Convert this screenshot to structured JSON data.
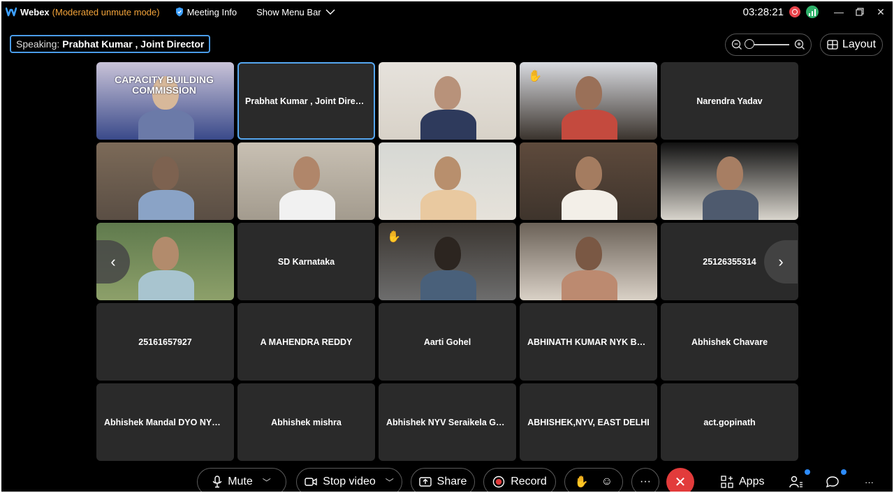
{
  "window": {
    "app_name": "Webex",
    "mode": "(Moderated unmute mode)",
    "meeting_info": "Meeting Info",
    "show_menu_bar": "Show Menu Bar",
    "clock": "03:28:21"
  },
  "speaking": {
    "label": "Speaking:",
    "name": "Prabhat Kumar , Joint Director"
  },
  "layout_button": "Layout",
  "tiles": [
    {
      "name": "",
      "video": true,
      "banner": "CAPACITY BUILDING COMMISSION"
    },
    {
      "name": "Prabhat Kumar , Joint Director",
      "video": false,
      "active": true
    },
    {
      "name": "",
      "video": true
    },
    {
      "name": "",
      "video": true,
      "hand": true
    },
    {
      "name": "Narendra Yadav",
      "video": false
    },
    {
      "name": "",
      "video": true
    },
    {
      "name": "",
      "video": true
    },
    {
      "name": "",
      "video": true
    },
    {
      "name": "",
      "video": true
    },
    {
      "name": "",
      "video": true
    },
    {
      "name": "",
      "video": true
    },
    {
      "name": "SD Karnataka",
      "video": false
    },
    {
      "name": "",
      "video": true,
      "hand": true
    },
    {
      "name": "",
      "video": true
    },
    {
      "name": "25126355314",
      "video": false
    },
    {
      "name": "25161657927",
      "video": false
    },
    {
      "name": "A MAHENDRA REDDY",
      "video": false
    },
    {
      "name": "Aarti Gohel",
      "video": false
    },
    {
      "name": "ABHINATH KUMAR NYK BH...",
      "video": false
    },
    {
      "name": "Abhishek Chavare",
      "video": false
    },
    {
      "name": "Abhishek Mandal DYO NYK ...",
      "video": false
    },
    {
      "name": "Abhishek mishra",
      "video": false
    },
    {
      "name": "Abhishek NYV Seraikela Gam...",
      "video": false
    },
    {
      "name": "ABHISHEK,NYV, EAST DELHI",
      "video": false
    },
    {
      "name": "act.gopinath",
      "video": false
    }
  ],
  "toolbar": {
    "mute": "Mute",
    "stop_video": "Stop video",
    "share": "Share",
    "record": "Record",
    "apps": "Apps"
  },
  "colors": {
    "accent": "#4a9ce8",
    "end_call": "#e23b3b",
    "moderated": "#f2a33a",
    "recording": "#e8434a",
    "stats": "#2fb16a"
  }
}
